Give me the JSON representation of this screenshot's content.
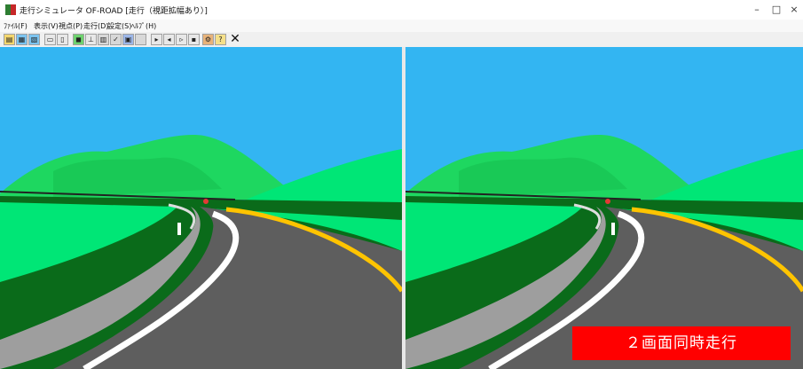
{
  "window": {
    "title": "走行シミュレータ OF-ROAD [走行（視距拡幅あり）]",
    "minimize": "–",
    "maximize": "□",
    "close": "×"
  },
  "menu": {
    "items": [
      "ﾌｧｲﾙ(F)",
      "表示(V)",
      "視点(P)",
      "走行(D)",
      "設定(S)",
      "ﾍﾙﾌﾟ(H)"
    ]
  },
  "toolbar": {
    "icons": [
      "open-folder-icon",
      "copy-icon",
      "paste-icon",
      "print-icon",
      "print-preview-icon",
      "cube-icon",
      "download-icon",
      "grid-icon",
      "check-icon",
      "save-icon",
      "blank-icon",
      "play-icon",
      "rewind-icon",
      "fast-forward-icon",
      "stop-icon",
      "settings-icon",
      "help-icon",
      "close-icon"
    ],
    "close_glyph": "✕"
  },
  "colors": {
    "sky": "#33b5f2",
    "road": "#5e5e5e",
    "grass": "#00e676",
    "hill": "#1ed760",
    "dark_grass": "#0a6b1a",
    "center_line": "#ffc400",
    "caption_bg": "#ff0000"
  },
  "caption": "２画面同時走行"
}
